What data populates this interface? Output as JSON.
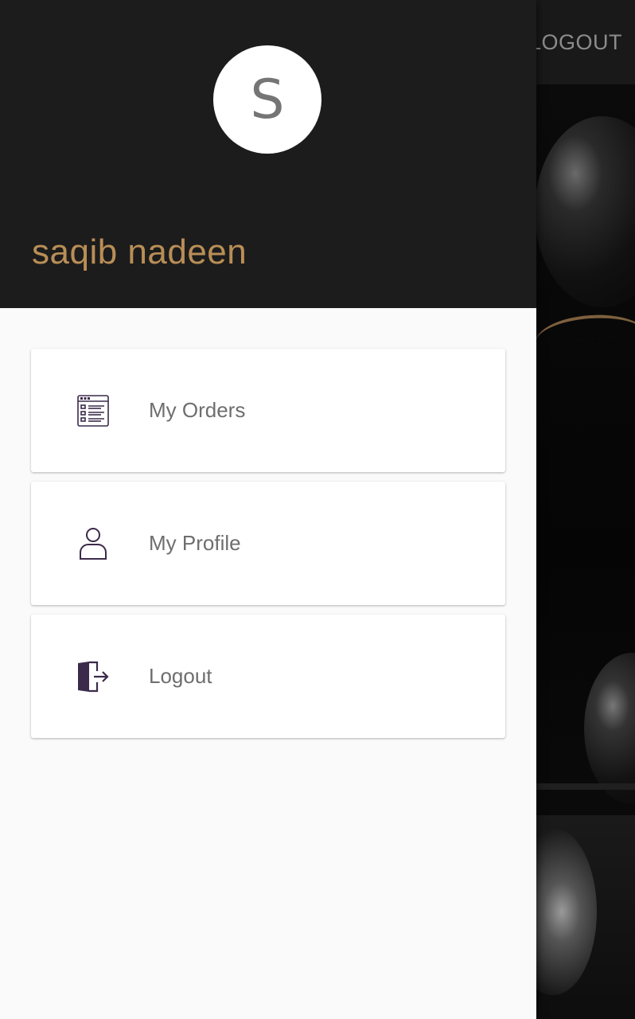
{
  "background": {
    "topbar": {
      "logout_label": "LOGOUT"
    }
  },
  "drawer": {
    "avatar_initial": "S",
    "user_name": "saqib nadeen",
    "colors": {
      "header_bg": "#1c1c1c",
      "name_color": "#b98e56",
      "icon_color": "#3b2a4a"
    },
    "menu": [
      {
        "label": "My Orders",
        "icon": "orders-list-icon"
      },
      {
        "label": "My Profile",
        "icon": "user-icon"
      },
      {
        "label": "Logout",
        "icon": "logout-door-icon"
      }
    ]
  }
}
